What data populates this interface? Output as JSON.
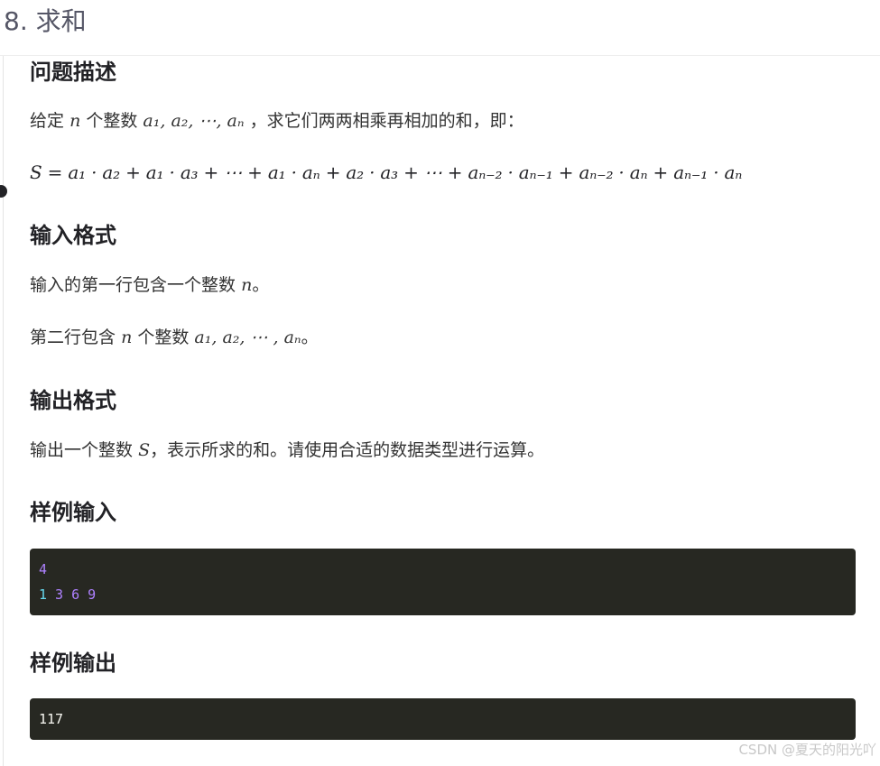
{
  "page": {
    "title": "8. 求和"
  },
  "sections": {
    "problem": {
      "heading": "问题描述",
      "intro_before": "给定",
      "intro_var": "n",
      "intro_mid": "个整数",
      "intro_seq": "a₁, a₂, ⋯, aₙ",
      "intro_after": "，求它们两两相乘再相加的和，即：",
      "formula": "S = a₁ · a₂ + a₁ · a₃ + ⋯ + a₁ · aₙ + a₂ · a₃ + ⋯ + aₙ₋₂ · aₙ₋₁ + aₙ₋₂ · aₙ + aₙ₋₁ · aₙ"
    },
    "input_format": {
      "heading": "输入格式",
      "line1_before": "输入的第一行包含一个整数",
      "line1_var": "n",
      "line1_after": "。",
      "line2_before": "第二行包含",
      "line2_var": "n",
      "line2_mid": "个整数",
      "line2_seq": "a₁, a₂, ⋯ , aₙ",
      "line2_after": "。"
    },
    "output_format": {
      "heading": "输出格式",
      "line_before": "输出一个整数",
      "line_var": "S",
      "line_after": "，表示所求的和。请使用合适的数据类型进行运算。"
    },
    "sample_input": {
      "heading": "样例输入",
      "line1": "4",
      "line2_first": "1",
      "line2_rest": " 3 6 9"
    },
    "sample_output": {
      "heading": "样例输出",
      "value": "117"
    }
  },
  "watermark": "CSDN @夏天的阳光吖",
  "colors": {
    "code_bg": "#272822",
    "code_number": "#ae81ff",
    "code_number_alt": "#66d9ef",
    "code_plain": "#f8f8f2"
  }
}
